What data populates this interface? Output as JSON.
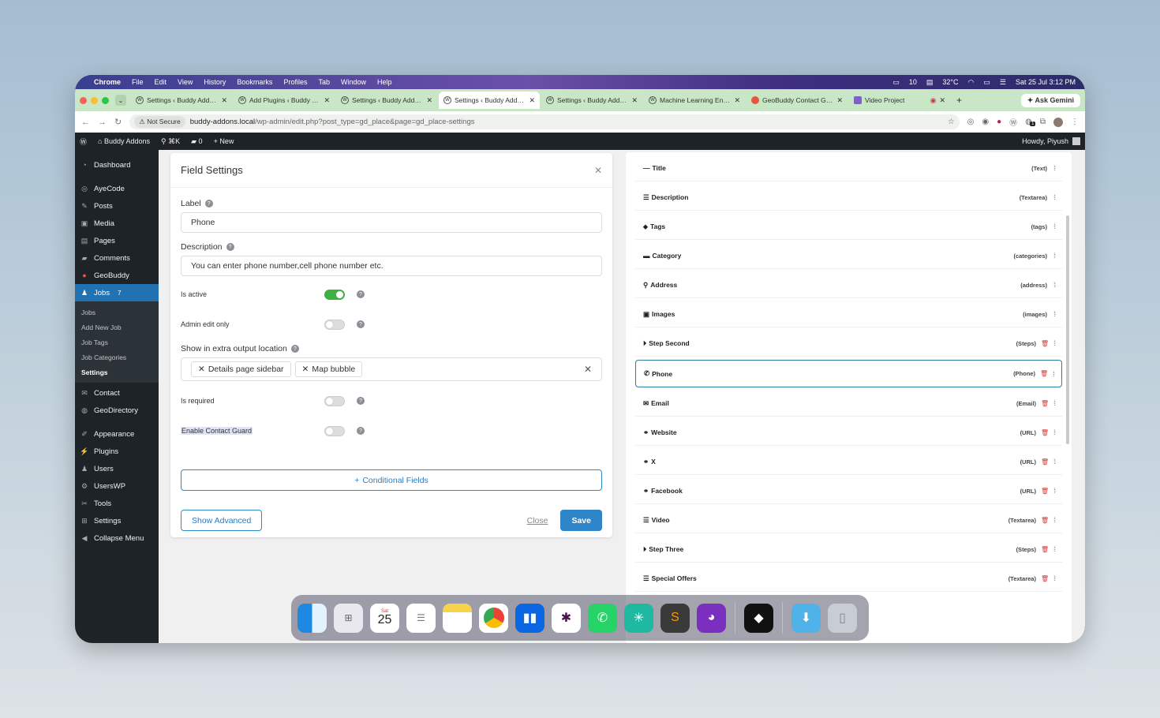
{
  "menubar": {
    "app": "Chrome",
    "items": [
      "File",
      "Edit",
      "View",
      "History",
      "Bookmarks",
      "Profiles",
      "Tab",
      "Window",
      "Help"
    ],
    "status": {
      "notif_count": "10",
      "weather": "32°C",
      "datetime": "Sat 25 Jul  3:12 PM"
    }
  },
  "tabs": [
    {
      "title": "Settings ‹ Buddy Addons",
      "active": false
    },
    {
      "title": "Add Plugins ‹ Buddy Addons",
      "active": false
    },
    {
      "title": "Settings ‹ Buddy Addons",
      "active": false
    },
    {
      "title": "Settings ‹ Buddy Addons",
      "active": true
    },
    {
      "title": "Settings ‹ Buddy Addons",
      "active": false
    },
    {
      "title": "Machine Learning Engineer",
      "active": false
    },
    {
      "title": "GeoBuddy Contact Guard",
      "active": false
    },
    {
      "title": "Video Project",
      "active": false
    }
  ],
  "ask_gemini": "Ask Gemini",
  "address": {
    "security": "Not Secure",
    "host": "buddy-addons.local",
    "path": "/wp-admin/edit.php?post_type=gd_place&page=gd_place-settings",
    "ext_badge": "1"
  },
  "adminbar": {
    "site": "Buddy Addons",
    "shortcut": "⌘K",
    "comments": "0",
    "new": "New",
    "howdy": "Howdy, Piyush"
  },
  "sidebar": {
    "items_top": [
      {
        "label": "Dashboard",
        "icon": "dashboard-icon"
      },
      {
        "label": "AyeCode",
        "icon": "ayecode-icon"
      },
      {
        "label": "Posts",
        "icon": "pin-icon"
      },
      {
        "label": "Media",
        "icon": "media-icon"
      },
      {
        "label": "Pages",
        "icon": "pages-icon"
      },
      {
        "label": "Comments",
        "icon": "comment-icon"
      },
      {
        "label": "GeoBuddy",
        "icon": "geobuddy-icon"
      }
    ],
    "active": {
      "label": "Jobs",
      "badge": "7"
    },
    "submenu": [
      "Jobs",
      "Add New Job",
      "Job Tags",
      "Job Categories",
      "Settings"
    ],
    "submenu_current": "Settings",
    "items_bottom": [
      {
        "label": "Contact",
        "icon": "mail-icon"
      },
      {
        "label": "GeoDirectory",
        "icon": "globe-icon"
      },
      {
        "label": "Appearance",
        "icon": "brush-icon"
      },
      {
        "label": "Plugins",
        "icon": "plug-icon"
      },
      {
        "label": "Users",
        "icon": "user-icon"
      },
      {
        "label": "UsersWP",
        "icon": "userswp-icon"
      },
      {
        "label": "Tools",
        "icon": "wrench-icon"
      },
      {
        "label": "Settings",
        "icon": "settings-icon"
      },
      {
        "label": "Collapse Menu",
        "icon": "collapse-icon"
      }
    ]
  },
  "modal": {
    "title": "Field Settings",
    "label_label": "Label",
    "label_value": "Phone",
    "description_label": "Description",
    "description_value": "You can enter phone number,cell phone number etc.",
    "is_active": "Is active",
    "admin_edit_only": "Admin edit only",
    "extra_output_label": "Show in extra output location",
    "chips": [
      "Details page sidebar",
      "Map bubble"
    ],
    "is_required": "Is required",
    "contact_guard": "Enable Contact Guard",
    "conditional_fields": "Conditional Fields",
    "show_advanced": "Show Advanced",
    "close": "Close",
    "save": "Save"
  },
  "fields": [
    {
      "name": "Title",
      "type": "(Text)",
      "icon": "minus-icon",
      "deletable": false
    },
    {
      "name": "Description",
      "type": "(Textarea)",
      "icon": "lines-icon",
      "deletable": false
    },
    {
      "name": "Tags",
      "type": "(tags)",
      "icon": "tag-icon",
      "deletable": false
    },
    {
      "name": "Category",
      "type": "(categories)",
      "icon": "folder-icon",
      "deletable": false
    },
    {
      "name": "Address",
      "type": "(address)",
      "icon": "map-pin-icon",
      "deletable": false
    },
    {
      "name": "Images",
      "type": "(images)",
      "icon": "image-icon",
      "deletable": false
    },
    {
      "name": "Step Second",
      "type": "(Steps)",
      "icon": "step-icon",
      "deletable": true
    },
    {
      "name": "Phone",
      "type": "(Phone)",
      "icon": "phone-icon",
      "deletable": true,
      "selected": true
    },
    {
      "name": "Email",
      "type": "(Email)",
      "icon": "envelope-icon",
      "deletable": true
    },
    {
      "name": "Website",
      "type": "(URL)",
      "icon": "link-icon",
      "deletable": true
    },
    {
      "name": "X",
      "type": "(URL)",
      "icon": "link-icon",
      "deletable": true
    },
    {
      "name": "Facebook",
      "type": "(URL)",
      "icon": "link-icon",
      "deletable": true
    },
    {
      "name": "Video",
      "type": "(Textarea)",
      "icon": "lines-icon",
      "deletable": true
    },
    {
      "name": "Step Three",
      "type": "(Steps)",
      "icon": "step-icon",
      "deletable": true
    },
    {
      "name": "Special Offers",
      "type": "(Textarea)",
      "icon": "lines-icon",
      "deletable": true
    }
  ],
  "dock": {
    "calendar_day": "Sat",
    "calendar_date": "25",
    "apps": [
      "Finder",
      "Launchpad",
      "Calendar",
      "Reminders",
      "Notes",
      "Chrome",
      "Trello",
      "Slack",
      "WhatsApp",
      "Perplexity",
      "Sublime Text",
      "GitHub Desktop",
      "Cursor",
      "Downloads",
      "Trash"
    ]
  },
  "colors": {
    "wp_blue": "#2271b1",
    "toggle_on": "#3db143",
    "accent": "#2e86c9",
    "delete": "#d63638"
  }
}
